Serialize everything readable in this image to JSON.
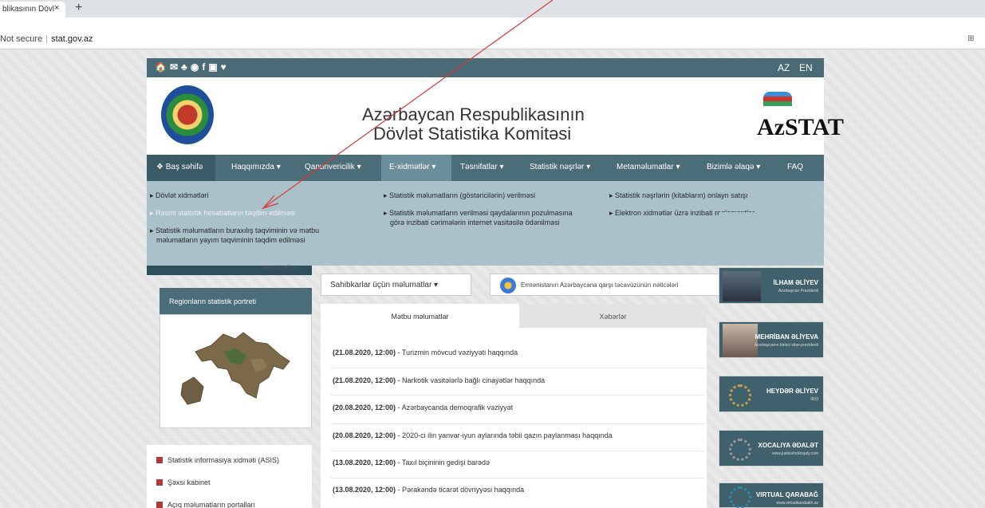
{
  "browser": {
    "tab_title": "blikasının Dövl",
    "tab_close": "×",
    "new_tab": "+",
    "security": "Not secure",
    "url": "stat.gov.az"
  },
  "topbar": {
    "social_icons": [
      "home-icon",
      "mail-icon",
      "sitemap-icon",
      "eye-icon",
      "facebook-icon",
      "youtube-icon",
      "twitter-icon"
    ],
    "social_glyphs": "🏠✉♣◉f▣♥",
    "lang_az": "AZ",
    "lang_en": "EN"
  },
  "header": {
    "title_line1": "Azərbaycan Respublikasının",
    "title_line2": "Dövlət Statistika Komitəsi",
    "logo_text": "AzSTAT"
  },
  "nav": {
    "items": [
      {
        "label": "❖ Baş səhifə"
      },
      {
        "label": "Haqqımızda ▾"
      },
      {
        "label": "Qanunvericilik ▾"
      },
      {
        "label": "E-xidmətlər ▾"
      },
      {
        "label": "Təsnifatlar ▾"
      },
      {
        "label": "Statistik nəşrlər ▾"
      },
      {
        "label": "Metaməlumatlar ▾"
      },
      {
        "label": "Bizimlə əlaqə ▾"
      },
      {
        "label": "FAQ"
      }
    ]
  },
  "dropdown": {
    "col1": [
      "▸ Dövlət xidmətləri",
      "▸ Rəsmi statistik hesabatların təqdim edilməsi",
      "▸ Statistik məlumatların buraxılış təqviminin və mətbu",
      "məlumatların yayım təqviminin təqdim edilməsi"
    ],
    "col2": [
      "▸ Statistik məlumatların (göstəricilərin) verilməsi",
      "▸ Statistik məlumatların verilməsi qaydalarının pozulmasına",
      "görə inzibati cərimələrin internet vasitəsilə ödənilməsi"
    ],
    "col3": [
      "▸ Statistik nəşrlərin (kitabların) onlayn satışı",
      "▸ Elektron xidmətlər üzrə inzibati reqlamentlər"
    ]
  },
  "left": {
    "strip_label": "Heydər Əliyev",
    "region_title": "Regionların statistik portreti",
    "links": [
      "Statistik informasiya xidməti (ASIS)",
      "Şəxsi kabinet",
      "Açıq məlumatların portalları"
    ]
  },
  "center": {
    "sahibkar_btn": "Sahibkarlar üçün məlumatlar ▾",
    "ermenistan_btn": "Ermənistanın Azərbaycana qarşı təcavüzünün nəticələri",
    "tab_matbu": "Mətbu məlumatlar",
    "tab_xeberler": "Xəbərlər",
    "news": [
      {
        "date": "(21.08.2020, 12:00)",
        "text": " - Turizmin mövcud vəziyyəti haqqında"
      },
      {
        "date": "(21.08.2020, 12:00)",
        "text": " - Narkotik vasitələrlə bağlı cinayətlər haqqında"
      },
      {
        "date": "(20.08.2020, 12:00)",
        "text": " - Azərbaycanda demoqrafik vəziyyət"
      },
      {
        "date": "(20.08.2020, 12:00)",
        "text": " - 2020-ci ilin yanvar-iyun aylarında təbii qazın paylanması haqqında"
      },
      {
        "date": "(13.08.2020, 12:00)",
        "text": " - Taxıl biçininin gedişi barədə"
      },
      {
        "date": "(13.08.2020, 12:00)",
        "text": " - Pərakəndə ticarət dövriyyəsi haqqında"
      }
    ]
  },
  "right": {
    "banners": [
      {
        "name": "İLHAM ƏLİYEV",
        "sub": "Azərbaycan Prezidenti"
      },
      {
        "name": "MEHRİBAN ƏLİYEVA",
        "sub": "Azərbaycanın birinci vitse-prezidenti"
      },
      {
        "name": "HEYDƏR ƏLİYEV",
        "sub": "İRSİ"
      },
      {
        "name": "XOCALIYA ƏDALƏT",
        "sub": "www.justiceforkhojaly.com"
      },
      {
        "name": "VIRTUAL QARABAĞ",
        "sub": "www.virtualkarabakh.az"
      }
    ]
  },
  "colors": {
    "nav_bg": "#4b6d78",
    "dropdown_bg": "#a9c0c9",
    "annotation_arrow": "#d63a3a"
  }
}
